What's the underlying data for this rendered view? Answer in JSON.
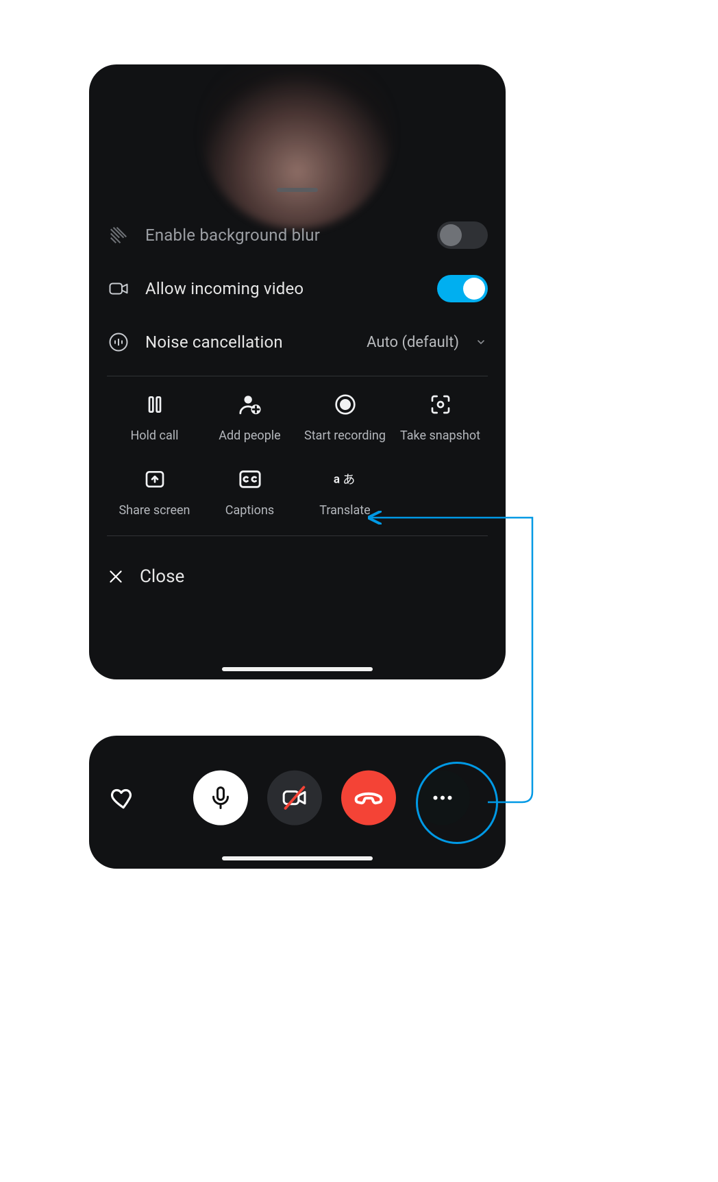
{
  "settings": {
    "blur": {
      "label": "Enable background blur",
      "enabled": false
    },
    "incoming": {
      "label": "Allow incoming video",
      "enabled": true
    },
    "noise": {
      "label": "Noise cancellation",
      "value": "Auto (default)"
    }
  },
  "actions": {
    "hold": "Hold call",
    "add": "Add people",
    "record": "Start recording",
    "snapshot": "Take snapshot",
    "share": "Share screen",
    "captions": "Captions",
    "translate": "Translate"
  },
  "close": {
    "label": "Close"
  }
}
